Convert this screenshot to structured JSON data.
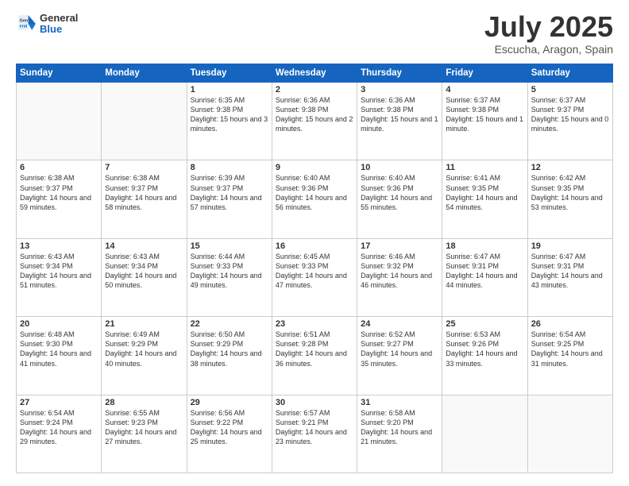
{
  "header": {
    "logo": {
      "general": "General",
      "blue": "Blue"
    },
    "month": "July 2025",
    "location": "Escucha, Aragon, Spain"
  },
  "weekdays": [
    "Sunday",
    "Monday",
    "Tuesday",
    "Wednesday",
    "Thursday",
    "Friday",
    "Saturday"
  ],
  "weeks": [
    [
      {
        "day": "",
        "content": ""
      },
      {
        "day": "",
        "content": ""
      },
      {
        "day": "1",
        "content": "Sunrise: 6:35 AM\nSunset: 9:38 PM\nDaylight: 15 hours\nand 3 minutes."
      },
      {
        "day": "2",
        "content": "Sunrise: 6:36 AM\nSunset: 9:38 PM\nDaylight: 15 hours\nand 2 minutes."
      },
      {
        "day": "3",
        "content": "Sunrise: 6:36 AM\nSunset: 9:38 PM\nDaylight: 15 hours\nand 1 minute."
      },
      {
        "day": "4",
        "content": "Sunrise: 6:37 AM\nSunset: 9:38 PM\nDaylight: 15 hours\nand 1 minute."
      },
      {
        "day": "5",
        "content": "Sunrise: 6:37 AM\nSunset: 9:37 PM\nDaylight: 15 hours\nand 0 minutes."
      }
    ],
    [
      {
        "day": "6",
        "content": "Sunrise: 6:38 AM\nSunset: 9:37 PM\nDaylight: 14 hours\nand 59 minutes."
      },
      {
        "day": "7",
        "content": "Sunrise: 6:38 AM\nSunset: 9:37 PM\nDaylight: 14 hours\nand 58 minutes."
      },
      {
        "day": "8",
        "content": "Sunrise: 6:39 AM\nSunset: 9:37 PM\nDaylight: 14 hours\nand 57 minutes."
      },
      {
        "day": "9",
        "content": "Sunrise: 6:40 AM\nSunset: 9:36 PM\nDaylight: 14 hours\nand 56 minutes."
      },
      {
        "day": "10",
        "content": "Sunrise: 6:40 AM\nSunset: 9:36 PM\nDaylight: 14 hours\nand 55 minutes."
      },
      {
        "day": "11",
        "content": "Sunrise: 6:41 AM\nSunset: 9:35 PM\nDaylight: 14 hours\nand 54 minutes."
      },
      {
        "day": "12",
        "content": "Sunrise: 6:42 AM\nSunset: 9:35 PM\nDaylight: 14 hours\nand 53 minutes."
      }
    ],
    [
      {
        "day": "13",
        "content": "Sunrise: 6:43 AM\nSunset: 9:34 PM\nDaylight: 14 hours\nand 51 minutes."
      },
      {
        "day": "14",
        "content": "Sunrise: 6:43 AM\nSunset: 9:34 PM\nDaylight: 14 hours\nand 50 minutes."
      },
      {
        "day": "15",
        "content": "Sunrise: 6:44 AM\nSunset: 9:33 PM\nDaylight: 14 hours\nand 49 minutes."
      },
      {
        "day": "16",
        "content": "Sunrise: 6:45 AM\nSunset: 9:33 PM\nDaylight: 14 hours\nand 47 minutes."
      },
      {
        "day": "17",
        "content": "Sunrise: 6:46 AM\nSunset: 9:32 PM\nDaylight: 14 hours\nand 46 minutes."
      },
      {
        "day": "18",
        "content": "Sunrise: 6:47 AM\nSunset: 9:31 PM\nDaylight: 14 hours\nand 44 minutes."
      },
      {
        "day": "19",
        "content": "Sunrise: 6:47 AM\nSunset: 9:31 PM\nDaylight: 14 hours\nand 43 minutes."
      }
    ],
    [
      {
        "day": "20",
        "content": "Sunrise: 6:48 AM\nSunset: 9:30 PM\nDaylight: 14 hours\nand 41 minutes."
      },
      {
        "day": "21",
        "content": "Sunrise: 6:49 AM\nSunset: 9:29 PM\nDaylight: 14 hours\nand 40 minutes."
      },
      {
        "day": "22",
        "content": "Sunrise: 6:50 AM\nSunset: 9:29 PM\nDaylight: 14 hours\nand 38 minutes."
      },
      {
        "day": "23",
        "content": "Sunrise: 6:51 AM\nSunset: 9:28 PM\nDaylight: 14 hours\nand 36 minutes."
      },
      {
        "day": "24",
        "content": "Sunrise: 6:52 AM\nSunset: 9:27 PM\nDaylight: 14 hours\nand 35 minutes."
      },
      {
        "day": "25",
        "content": "Sunrise: 6:53 AM\nSunset: 9:26 PM\nDaylight: 14 hours\nand 33 minutes."
      },
      {
        "day": "26",
        "content": "Sunrise: 6:54 AM\nSunset: 9:25 PM\nDaylight: 14 hours\nand 31 minutes."
      }
    ],
    [
      {
        "day": "27",
        "content": "Sunrise: 6:54 AM\nSunset: 9:24 PM\nDaylight: 14 hours\nand 29 minutes."
      },
      {
        "day": "28",
        "content": "Sunrise: 6:55 AM\nSunset: 9:23 PM\nDaylight: 14 hours\nand 27 minutes."
      },
      {
        "day": "29",
        "content": "Sunrise: 6:56 AM\nSunset: 9:22 PM\nDaylight: 14 hours\nand 25 minutes."
      },
      {
        "day": "30",
        "content": "Sunrise: 6:57 AM\nSunset: 9:21 PM\nDaylight: 14 hours\nand 23 minutes."
      },
      {
        "day": "31",
        "content": "Sunrise: 6:58 AM\nSunset: 9:20 PM\nDaylight: 14 hours\nand 21 minutes."
      },
      {
        "day": "",
        "content": ""
      },
      {
        "day": "",
        "content": ""
      }
    ]
  ]
}
